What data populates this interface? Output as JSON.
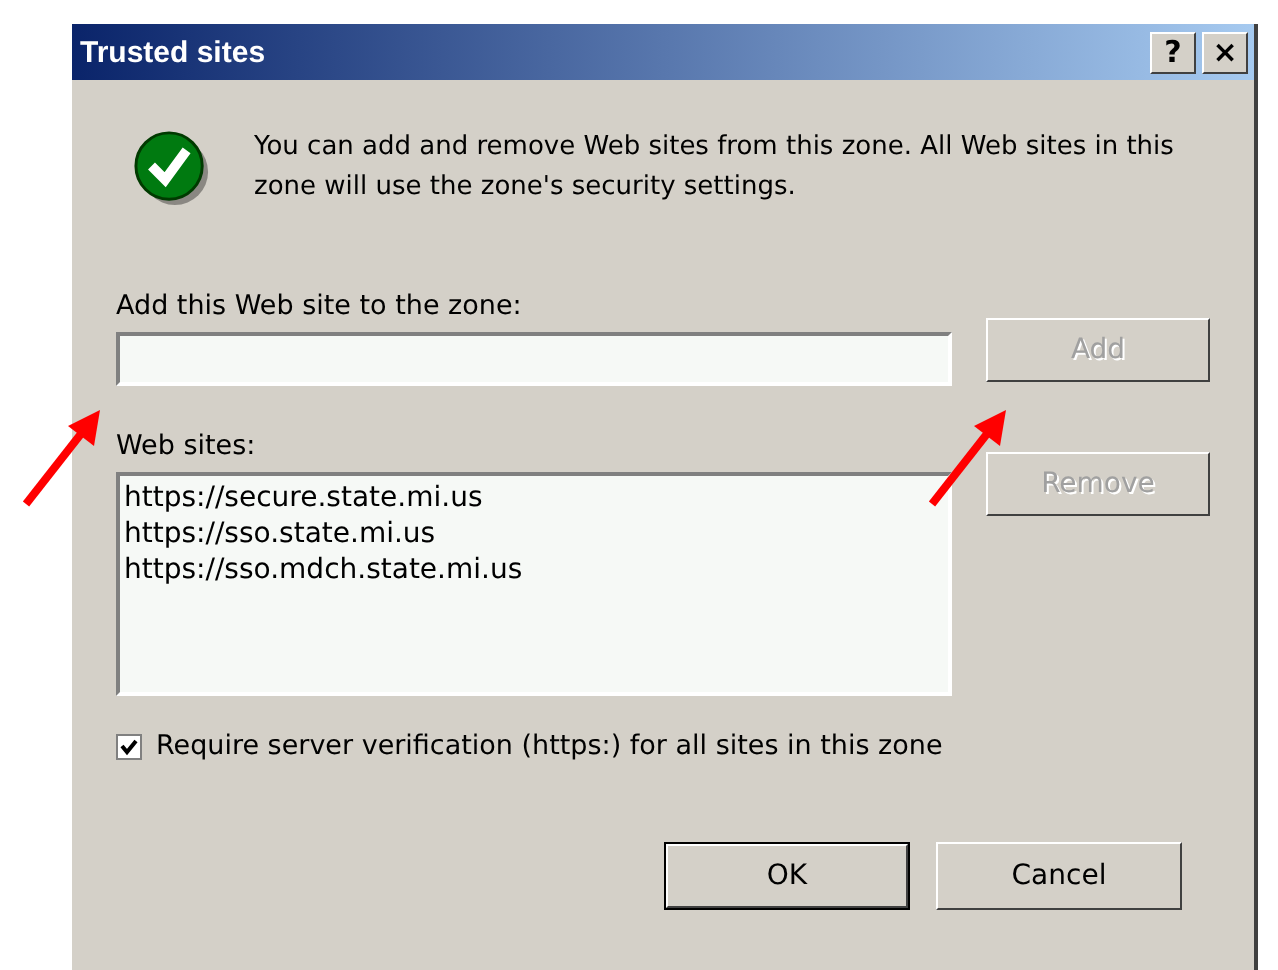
{
  "window": {
    "title": "Trusted sites",
    "title_buttons": [
      "?",
      "×"
    ]
  },
  "info": "You can add and remove Web sites from this zone. All Web sites in this zone will use the zone's security settings.",
  "add_field": {
    "label": "Add this Web site to the zone:"
  },
  "add_button": {
    "label": "Add",
    "disabled": true
  },
  "list": {
    "label": "Web sites:",
    "items": [
      "https://secure.state.mi.us",
      "https://sso.state.mi.us",
      "https://sso.mdch.state.mi.us"
    ]
  },
  "remove_button": {
    "label": "Remove",
    "disabled": true
  },
  "require_https": {
    "label": "Require server verification (https:) for all sites in this zone",
    "checked": true
  },
  "buttons": [
    {
      "label": "OK",
      "default": true
    },
    {
      "label": "Cancel",
      "default": false
    }
  ]
}
